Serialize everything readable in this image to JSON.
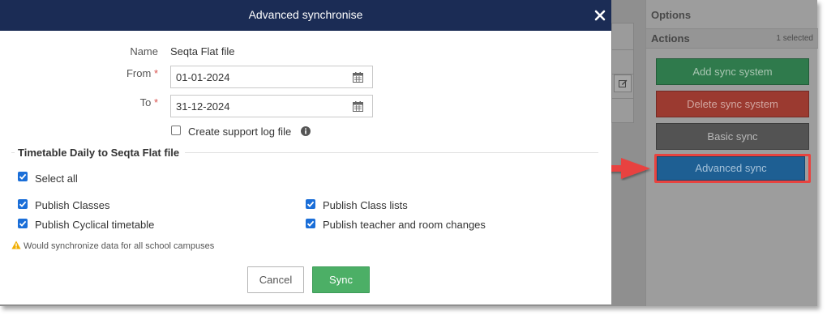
{
  "modal": {
    "title": "Advanced synchronise",
    "name_label": "Name",
    "name_value": "Seqta Flat file",
    "from_label": "From",
    "from_value": "01-01-2024",
    "to_label": "To",
    "to_value": "31-12-2024",
    "required_mark": "*",
    "support_log_label": "Create support log file",
    "support_log_checked": false,
    "section_title": "Timetable Daily to Seqta Flat file",
    "select_all_label": "Select all",
    "options": [
      {
        "label": "Publish Classes",
        "checked": true
      },
      {
        "label": "Publish Class lists",
        "checked": true
      },
      {
        "label": "Publish Cyclical timetable",
        "checked": true
      },
      {
        "label": "Publish teacher and room changes",
        "checked": true
      }
    ],
    "warning_text": "Would synchronize data for all school campuses",
    "cancel_label": "Cancel",
    "sync_label": "Sync"
  },
  "sidebar": {
    "options_title": "Options",
    "actions_title": "Actions",
    "selected_count": "1 selected",
    "buttons": [
      {
        "label": "Add sync system"
      },
      {
        "label": "Delete sync system"
      },
      {
        "label": "Basic sync"
      },
      {
        "label": "Advanced sync"
      }
    ]
  },
  "colors": {
    "header": "#1b2c55",
    "sync_button": "#4caf66",
    "checkbox": "#1a6ed8",
    "highlight": "#e8433f",
    "warning": "#f0ad00"
  }
}
